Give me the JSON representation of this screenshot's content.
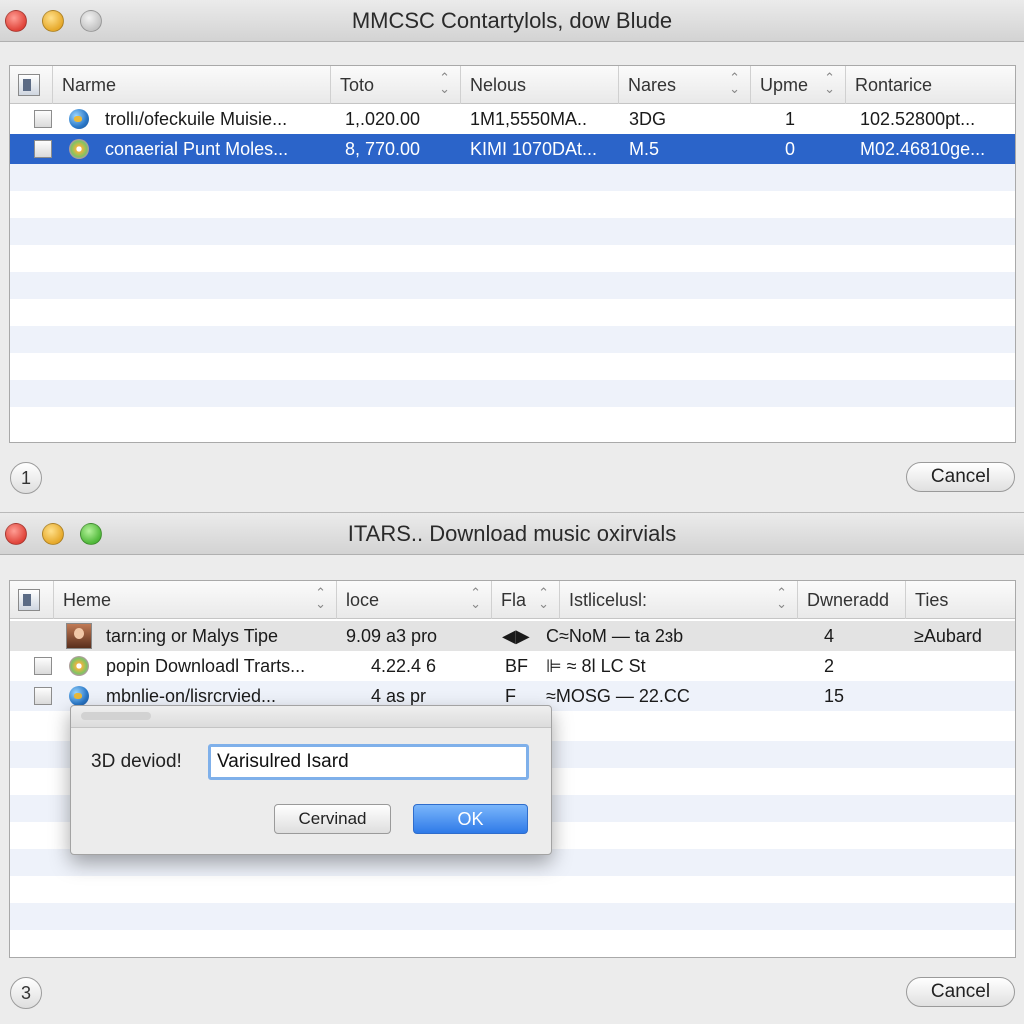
{
  "window1": {
    "title": "MMCSC Contartylols, dow Blude",
    "columns": [
      "Narme",
      "Toto",
      "Nelous",
      "Nares",
      "Upme",
      "Rontarice"
    ],
    "rows": [
      {
        "name": "trollı/ofeckuile Muisie...",
        "c1": "1,.020.00",
        "c2": "1M1,5550MA..",
        "c3": "3DG",
        "c4": "1",
        "c5": "102.52800pt..."
      },
      {
        "name": "conaerial Punt Moles...",
        "c1": "8, 770.00",
        "c2": "KIMI 1070DAt...",
        "c3": "M.5",
        "c4": "0",
        "c5": "M02.46810ge..."
      }
    ],
    "page_button": "1",
    "cancel_label": "Cancel"
  },
  "window2": {
    "title": "ITARS.. Download music oxirvials",
    "columns": [
      "Heme",
      "loce",
      "Fla",
      "Istlicelusl:",
      "Dwneradd",
      "Ties"
    ],
    "rows": [
      {
        "name": "tarn:ing or Malys Tipe",
        "c1": "9.09 a3 pro",
        "c2": "◀▶",
        "c3": "C≈NoM — ta 2ɜb",
        "c4": "4",
        "c5": "≥Aubard"
      },
      {
        "name": "popin Downloadl Trarts...",
        "c1": "4.22.4 6",
        "c2": "BF",
        "c3": "⊫ ≈ 8l LC St",
        "c4": "2",
        "c5": ""
      },
      {
        "name": "mbnlie-on/lisrcrvied...",
        "c1": "4 as pr",
        "c2": "F",
        "c3": "≈MOSG — 22.CC",
        "c4": "15",
        "c5": ""
      }
    ],
    "page_button": "3",
    "cancel_label": "Cancel"
  },
  "dialog": {
    "label": "3D deviod!",
    "input_value": "Varisulred Isard",
    "cancel_label": "Cervinad",
    "ok_label": "OK"
  },
  "colors": {
    "selection": "#2b64c9",
    "ok_button": "#2f7ae8",
    "stripe": "#eef2fa"
  }
}
